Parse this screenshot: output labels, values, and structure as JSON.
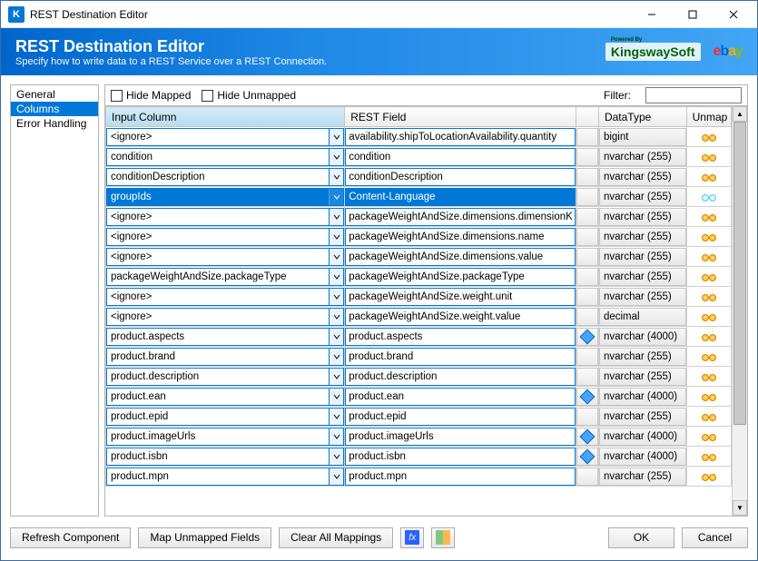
{
  "window": {
    "title": "REST Destination Editor"
  },
  "banner": {
    "title": "REST Destination Editor",
    "subtitle": "Specify how to write data to a REST Service over a REST Connection.",
    "powered_by": "Powered By",
    "ks": "KingswaySoft",
    "ebay": {
      "e": "e",
      "b": "b",
      "a": "a",
      "y": "y"
    }
  },
  "sidebar": {
    "items": [
      {
        "label": "General",
        "selected": false
      },
      {
        "label": "Columns",
        "selected": true
      },
      {
        "label": "Error Handling",
        "selected": false
      }
    ]
  },
  "toolbar": {
    "hide_mapped": "Hide Mapped",
    "hide_unmapped": "Hide Unmapped",
    "filter_label": "Filter:",
    "filter_value": ""
  },
  "grid": {
    "headers": {
      "input": "Input Column",
      "rest": "REST Field",
      "icon": "",
      "datatype": "DataType",
      "unmap": "Unmap"
    },
    "rows": [
      {
        "input": "<ignore>",
        "rest": "availability.shipToLocationAvailability.quantity",
        "datatype": "bigint",
        "icon": "",
        "selected": false
      },
      {
        "input": "condition",
        "rest": "condition",
        "datatype": "nvarchar (255)",
        "icon": "",
        "selected": false
      },
      {
        "input": "conditionDescription",
        "rest": "conditionDescription",
        "datatype": "nvarchar (255)",
        "icon": "",
        "selected": false
      },
      {
        "input": "groupIds",
        "rest": "Content-Language",
        "datatype": "nvarchar (255)",
        "icon": "",
        "selected": true
      },
      {
        "input": "<ignore>",
        "rest": "packageWeightAndSize.dimensions.dimensionKey",
        "datatype": "nvarchar (255)",
        "icon": "",
        "selected": false
      },
      {
        "input": "<ignore>",
        "rest": "packageWeightAndSize.dimensions.name",
        "datatype": "nvarchar (255)",
        "icon": "",
        "selected": false
      },
      {
        "input": "<ignore>",
        "rest": "packageWeightAndSize.dimensions.value",
        "datatype": "nvarchar (255)",
        "icon": "",
        "selected": false
      },
      {
        "input": "packageWeightAndSize.packageType",
        "rest": "packageWeightAndSize.packageType",
        "datatype": "nvarchar (255)",
        "icon": "",
        "selected": false
      },
      {
        "input": "<ignore>",
        "rest": "packageWeightAndSize.weight.unit",
        "datatype": "nvarchar (255)",
        "icon": "",
        "selected": false
      },
      {
        "input": "<ignore>",
        "rest": "packageWeightAndSize.weight.value",
        "datatype": "decimal",
        "icon": "",
        "selected": false
      },
      {
        "input": "product.aspects",
        "rest": "product.aspects",
        "datatype": "nvarchar (4000)",
        "icon": "diamond",
        "selected": false
      },
      {
        "input": "product.brand",
        "rest": "product.brand",
        "datatype": "nvarchar (255)",
        "icon": "",
        "selected": false
      },
      {
        "input": "product.description",
        "rest": "product.description",
        "datatype": "nvarchar (255)",
        "icon": "",
        "selected": false
      },
      {
        "input": "product.ean",
        "rest": "product.ean",
        "datatype": "nvarchar (4000)",
        "icon": "diamond",
        "selected": false
      },
      {
        "input": "product.epid",
        "rest": "product.epid",
        "datatype": "nvarchar (255)",
        "icon": "",
        "selected": false
      },
      {
        "input": "product.imageUrls",
        "rest": "product.imageUrls",
        "datatype": "nvarchar (4000)",
        "icon": "diamond",
        "selected": false
      },
      {
        "input": "product.isbn",
        "rest": "product.isbn",
        "datatype": "nvarchar (4000)",
        "icon": "diamond",
        "selected": false
      },
      {
        "input": "product.mpn",
        "rest": "product.mpn",
        "datatype": "nvarchar (255)",
        "icon": "",
        "selected": false
      }
    ]
  },
  "footer": {
    "refresh": "Refresh Component",
    "map_unmapped": "Map Unmapped Fields",
    "clear_all": "Clear All Mappings",
    "ok": "OK",
    "cancel": "Cancel"
  }
}
